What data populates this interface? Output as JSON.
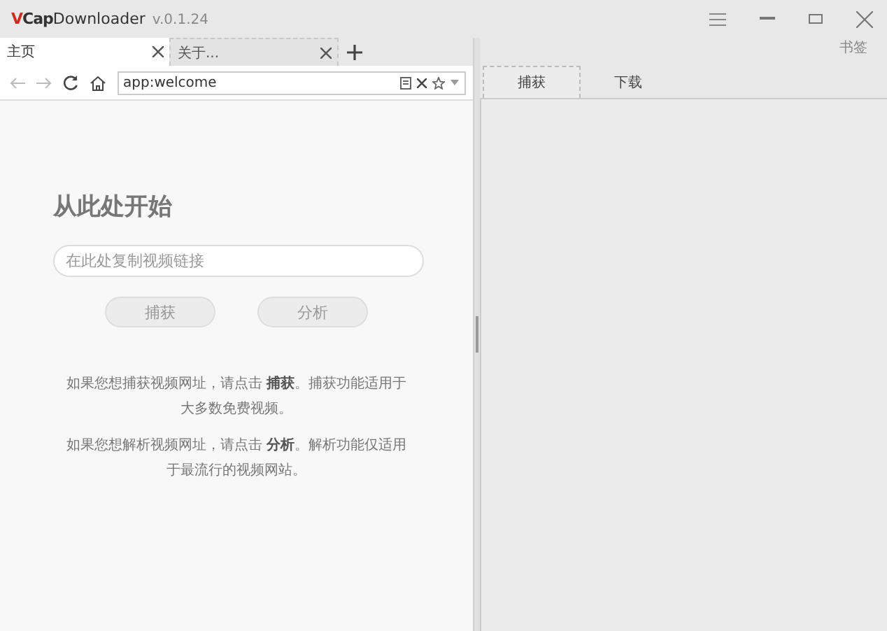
{
  "window": {
    "logo_mark": "V",
    "logo_rest": "Cap",
    "app_name": "Downloader",
    "version": "v.0.1.24"
  },
  "bookmarks_label": "书签",
  "browser_tabs": [
    {
      "label": "主页",
      "selected": true
    },
    {
      "label": "关于...",
      "selected": false
    }
  ],
  "address_bar": {
    "value": "app:welcome"
  },
  "welcome": {
    "heading": "从此处开始",
    "link_field": {
      "placeholder": "在此处复制视频链接"
    },
    "buttons": [
      "捕获",
      "分析"
    ],
    "paragraphs": [
      "如果您想捕获视频网址，请点击 **捕获**。捕获功能适用于大多数免费视频。",
      "如果您想解析视频网址，请点击 **分析**。解析功能仅适用于最流行的视频网站。"
    ]
  },
  "panel_tabs": [
    {
      "label": "捕获",
      "selected": true
    },
    {
      "label": "下载",
      "selected": false
    }
  ]
}
